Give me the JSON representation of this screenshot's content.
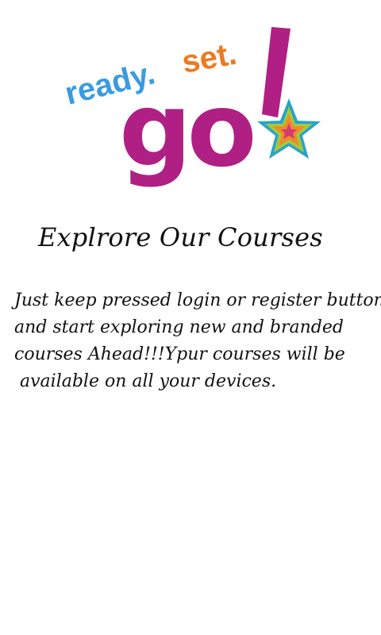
{
  "logo": {
    "word_ready": "ready.",
    "word_set": "set.",
    "word_go": "go",
    "colors": {
      "ready": "#3a9be0",
      "set": "#ee7a20",
      "go": "#b01f84",
      "star_outer": "#2aa3c9",
      "star_mid": "#a6c93a",
      "star_inner": "#f08a2c",
      "star_core": "#d63a6e"
    },
    "star_icon": "star-icon"
  },
  "screen": {
    "title": "Explrore Our Courses",
    "description_lines": [
      "Just keep pressed login or register button",
      "and start exploring new and branded",
      "courses Ahead!!!Ypur courses will be",
      " available on all your devices."
    ]
  }
}
